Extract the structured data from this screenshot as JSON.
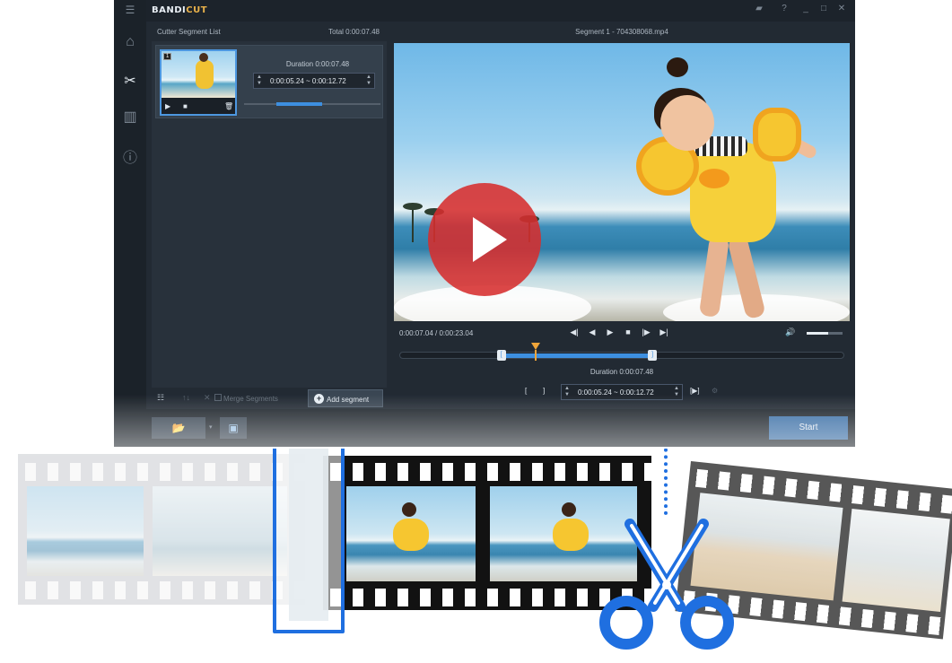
{
  "app": {
    "logo_main": "BANDI",
    "logo_accent": "CUT",
    "titlebar_icons": [
      "folder-icon",
      "help-icon",
      "minimize-icon",
      "maximize-icon",
      "close-icon"
    ]
  },
  "nav": {
    "items": [
      "menu-icon",
      "home-icon",
      "cut-icon",
      "encode-icon",
      "info-icon",
      "settings-icon"
    ]
  },
  "segment_list": {
    "title": "Cutter Segment List",
    "total": "Total 0:00:07.48",
    "items": [
      {
        "number": "1",
        "duration": "Duration 0:00:07.48",
        "range": "0:00:05.24 ~ 0:00:12.72",
        "progress_start": 0.24,
        "progress_end": 0.57
      }
    ],
    "merge_label": "Merge Segments",
    "add_label": "Add segment"
  },
  "player": {
    "title": "Segment 1 - 704308068.mp4",
    "time": "0:00:07.04 / 0:00:23.04",
    "duration": "Duration 0:00:07.48",
    "range": "0:00:05.24 ~ 0:00:12.72",
    "bracket_start": "[",
    "bracket_end": "]",
    "segment_start_fraction": 0.228,
    "segment_end_fraction": 0.569,
    "playhead_fraction": 0.306,
    "volume_fraction": 0.6
  },
  "bottom": {
    "start_label": "Start"
  },
  "colors": {
    "accent": "#3d8fe0",
    "play_red": "#d62d2d",
    "marker": "#f0a53a",
    "scissors": "#1f6fe0"
  }
}
